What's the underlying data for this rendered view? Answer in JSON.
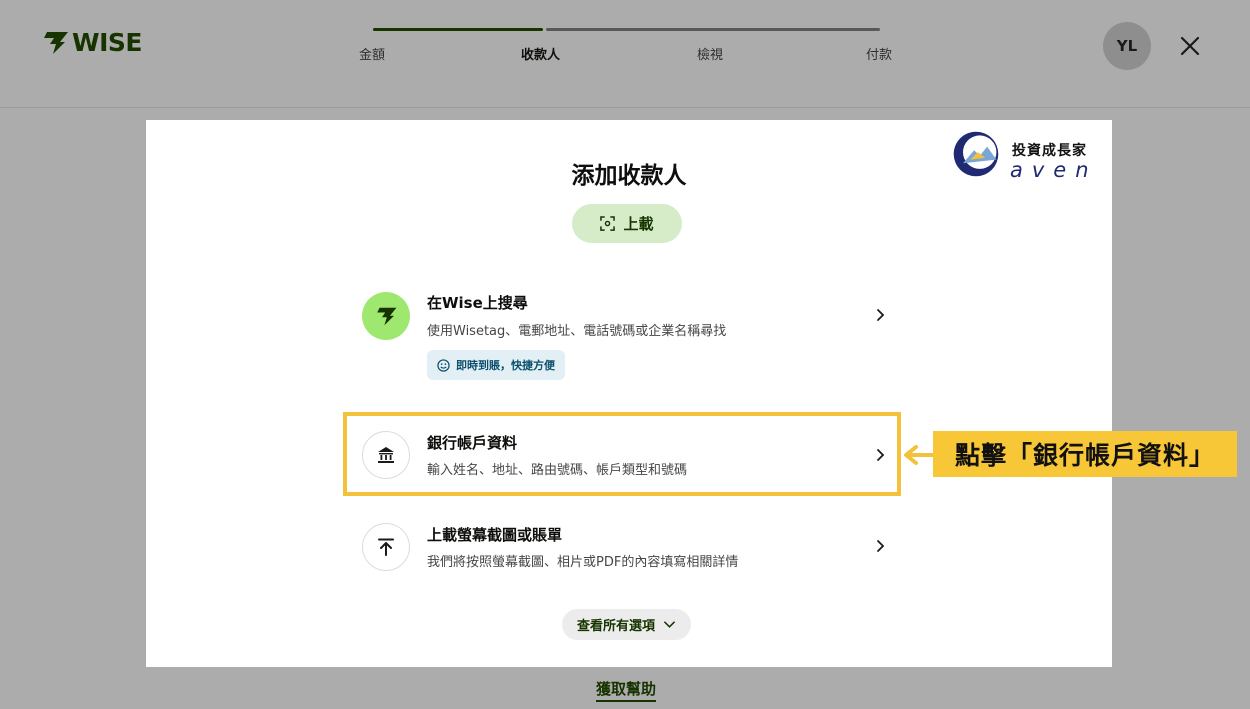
{
  "header": {
    "logo_text": "WISE",
    "steps": [
      {
        "label": "金額",
        "state": "done"
      },
      {
        "label": "收款人",
        "state": "active"
      },
      {
        "label": "檢視",
        "state": "todo"
      },
      {
        "label": "付款",
        "state": "todo"
      }
    ],
    "avatar_initials": "YL",
    "close_icon": "close-icon"
  },
  "modal": {
    "title": "添加收款人",
    "upload_label": "上載",
    "watermark": {
      "line1": "投資成長家",
      "line2": "aven"
    },
    "options": [
      {
        "title": "在Wise上搜尋",
        "description": "使用Wisetag、電郵地址、電話號碼或企業名稱尋找",
        "tag": "即時到賬，快捷方便",
        "icon": "wise-logo-icon"
      },
      {
        "title": "銀行帳戶資料",
        "description": "輸入姓名、地址、路由號碼、帳戶類型和號碼",
        "icon": "bank-icon"
      },
      {
        "title": "上載螢幕截圖或賬單",
        "description": "我們將按照螢幕截圖、相片或PDF的內容填寫相關詳情",
        "icon": "upload-arrow-icon"
      }
    ],
    "view_all_label": "查看所有選項"
  },
  "annotation": {
    "callout_text": "點擊「銀行帳戶資料」",
    "color": "#f7c737"
  },
  "footer": {
    "help_link": "獲取幫助"
  },
  "colors": {
    "brand_green": "#163300",
    "accent_green": "#9fe870",
    "overlay": "#acacac"
  }
}
